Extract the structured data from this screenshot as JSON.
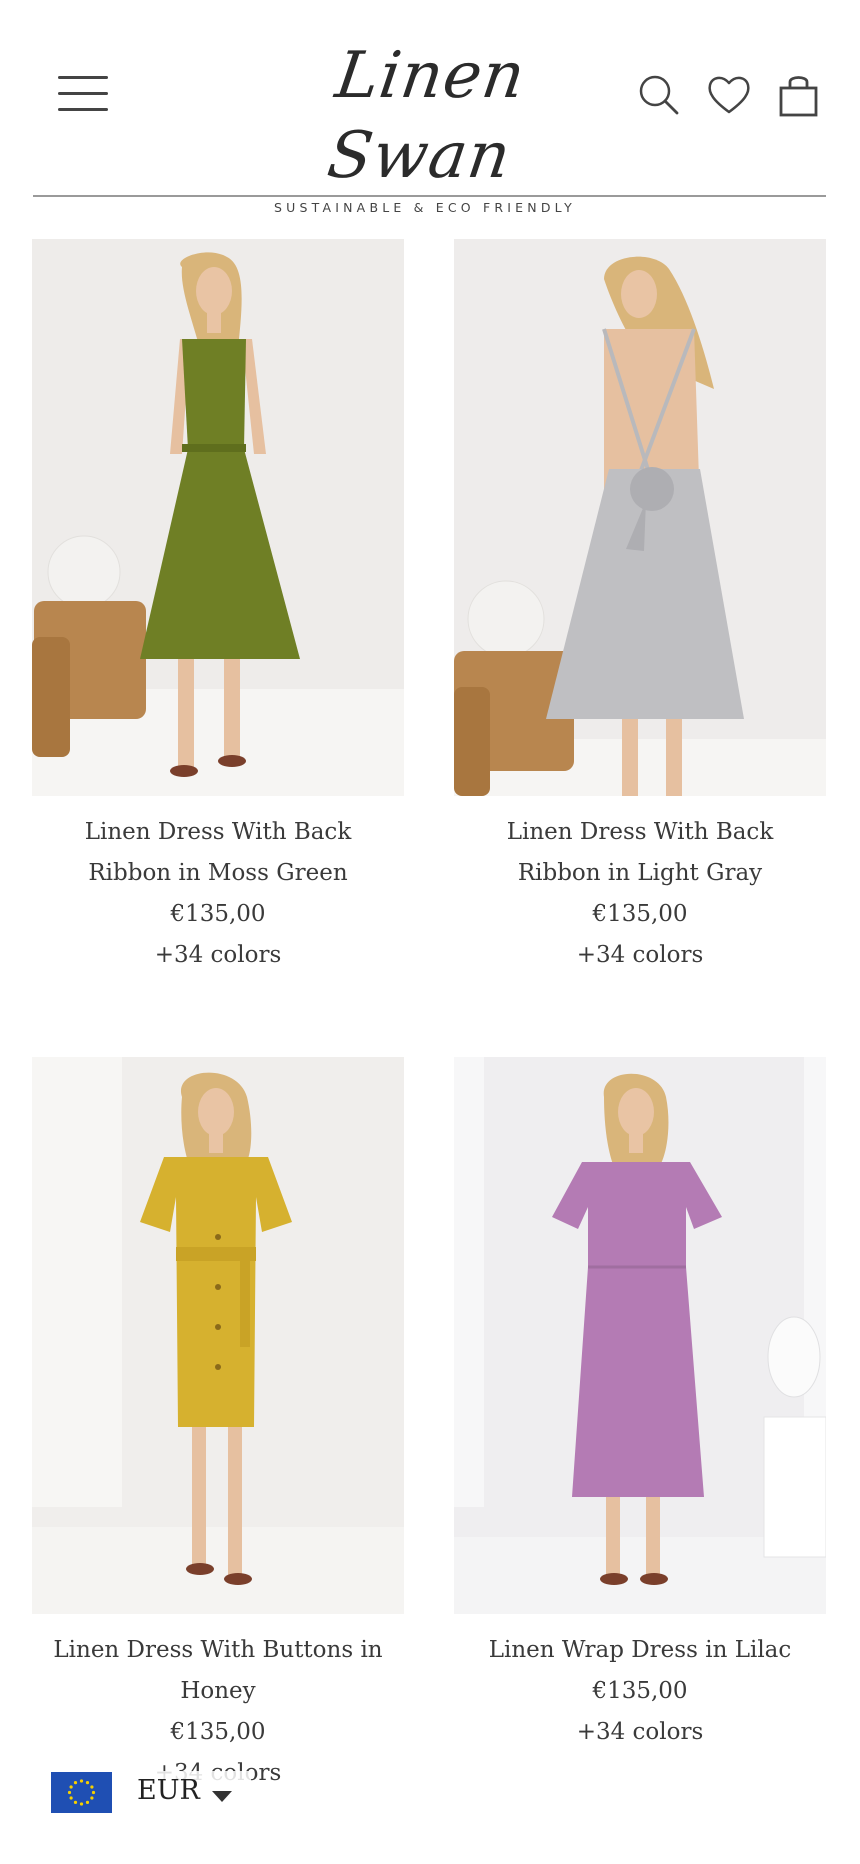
{
  "header": {
    "brand_name": "Linen Swan",
    "brand_tagline": "SUSTAINABLE & ECO FRIENDLY",
    "icons": [
      "menu-icon",
      "search-icon",
      "heart-icon",
      "bag-icon"
    ]
  },
  "products": [
    {
      "title": "Linen Dress With Back Ribbon in Moss Green",
      "price": "€135,00",
      "colors": "+34 colors",
      "dress_color": "#6f7f25",
      "bg_color": "#eeecea"
    },
    {
      "title": "Linen Dress With Back Ribbon in Light Gray",
      "price": "€135,00",
      "colors": "+34 colors",
      "dress_color": "#bfbfc2",
      "bg_color": "#eeeceb"
    },
    {
      "title": "Linen Dress With Buttons in Honey",
      "price": "€135,00",
      "colors": "+34 colors",
      "dress_color": "#d6b12f",
      "bg_color": "#f0eeec"
    },
    {
      "title": "Linen Wrap Dress in Lilac",
      "price": "€135,00",
      "colors": "+34 colors",
      "dress_color": "#b47bb4",
      "bg_color": "#efeef0"
    }
  ],
  "currency": {
    "code": "EUR",
    "flag": "eu-flag-icon"
  }
}
